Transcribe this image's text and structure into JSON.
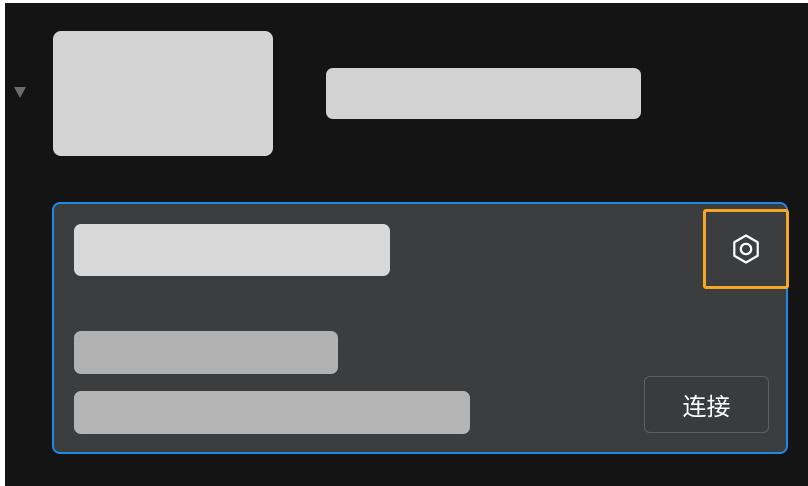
{
  "device_card": {
    "connect_label": "连接",
    "icon": "gear-icon"
  },
  "colors": {
    "background": "#141414",
    "card_background": "#3c3d3f",
    "card_border_selected": "#1e88e5",
    "highlight": "#f5a623",
    "placeholder": "#d3d3d3"
  }
}
